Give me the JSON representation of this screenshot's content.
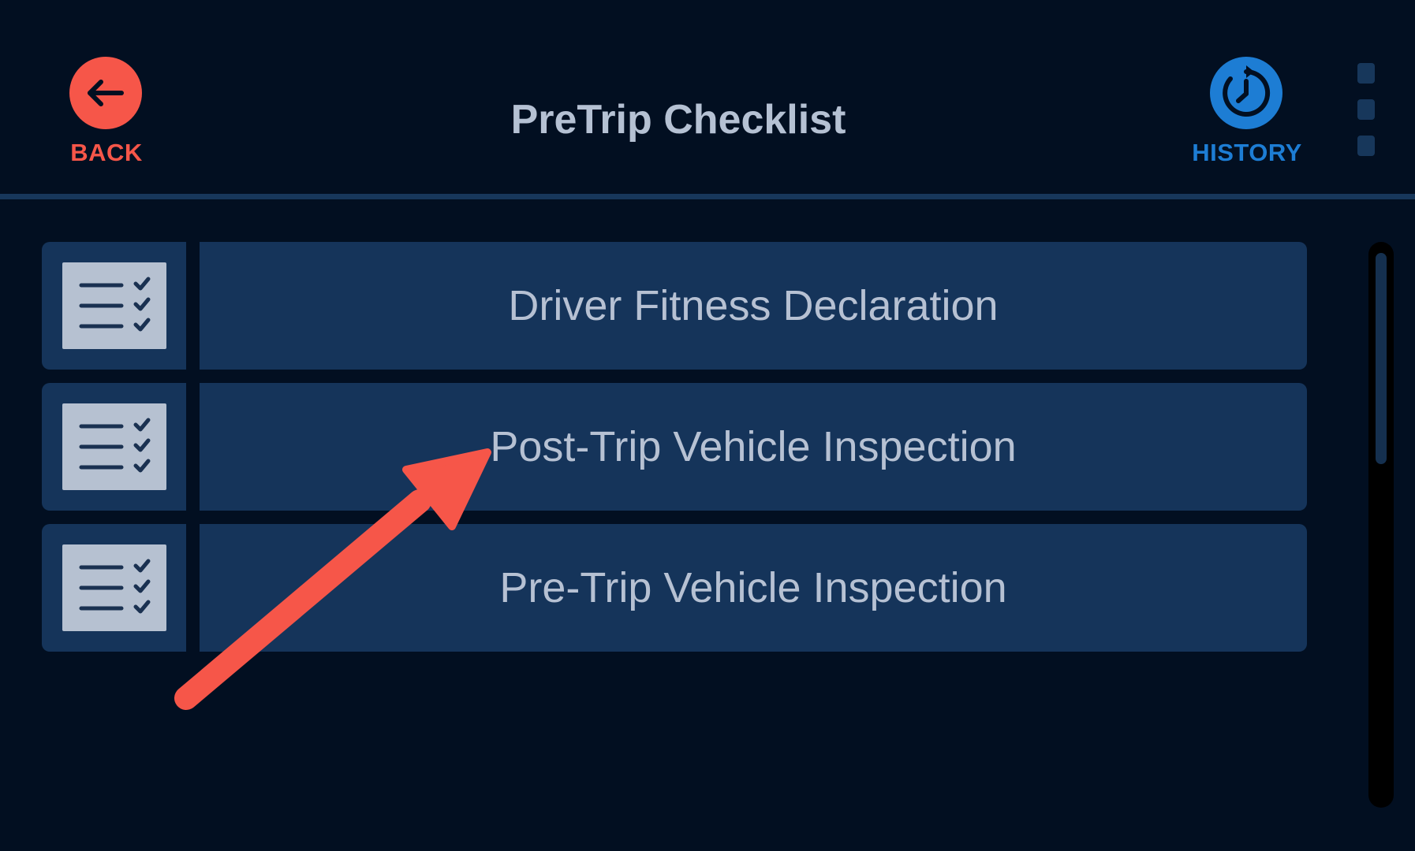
{
  "header": {
    "back_label": "BACK",
    "title": "PreTrip Checklist",
    "history_label": "HISTORY"
  },
  "checklist": {
    "items": [
      {
        "label": "Driver Fitness Declaration"
      },
      {
        "label": "Post-Trip Vehicle Inspection"
      },
      {
        "label": "Pre-Trip Vehicle Inspection"
      }
    ]
  },
  "icons": {
    "back": "arrow-left-icon",
    "history": "clock-history-icon",
    "menu": "vertical-dots-icon",
    "item": "checklist-icon"
  },
  "colors": {
    "background": "#020f21",
    "back_accent": "#f65649",
    "history_accent": "#1d7dd4",
    "row_background": "#15345a",
    "text": "#b6c1d3",
    "annotation_arrow": "#f65649"
  }
}
